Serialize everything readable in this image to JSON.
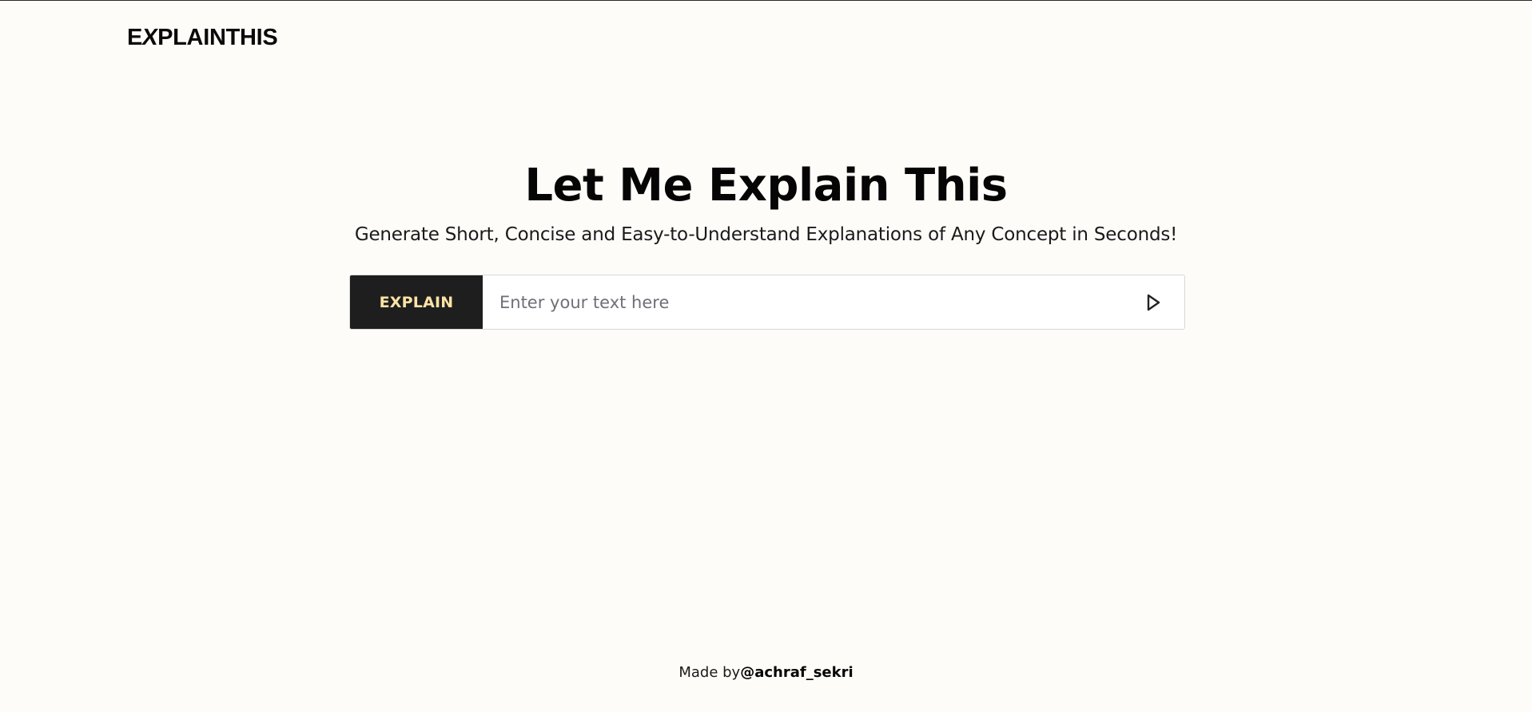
{
  "header": {
    "logo_part1": "E",
    "logo_part2": "X",
    "logo_part3": "PLAINTHIS"
  },
  "hero": {
    "title": "Let Me Explain This",
    "subtitle": "Generate Short, Concise and Easy-to-Understand Explanations of Any Concept in Seconds!"
  },
  "explain_bar": {
    "button_label": "EXPLAIN",
    "input_value": "",
    "input_placeholder": "Enter your text here",
    "send_icon": "play-triangle-icon"
  },
  "footer": {
    "made_by_label": "Made by",
    "author_handle": "@achraf_sekri"
  },
  "colors": {
    "background": "#fdfcf8",
    "button_bg": "#1e1e1e",
    "button_text": "#fbe3a5",
    "input_border": "#d7d7dc"
  }
}
